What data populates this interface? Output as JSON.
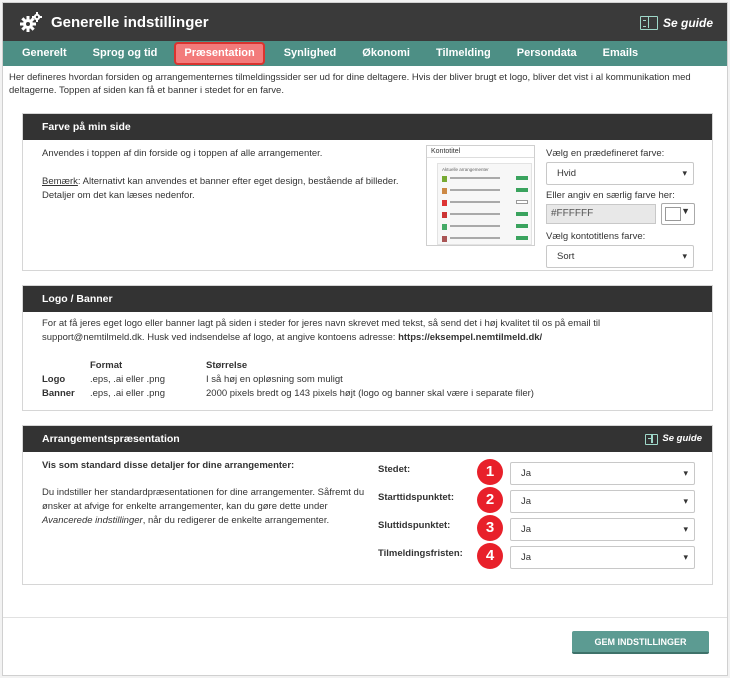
{
  "titlebar": {
    "title": "Generelle indstillinger",
    "guide_label": "Se guide"
  },
  "nav": {
    "tabs": [
      {
        "label": "Generelt",
        "active": false
      },
      {
        "label": "Sprog og tid",
        "active": false
      },
      {
        "label": "Præsentation",
        "active": true
      },
      {
        "label": "Synlighed",
        "active": false
      },
      {
        "label": "Økonomi",
        "active": false
      },
      {
        "label": "Tilmelding",
        "active": false
      },
      {
        "label": "Persondata",
        "active": false
      },
      {
        "label": "Emails",
        "active": false
      }
    ]
  },
  "intro": "Her defineres hvordan forsiden og arrangementernes tilmeldingssider ser ud for dine deltagere. Hvis der bliver brugt et logo, bliver det vist i al kommunikation med deltagerne. Toppen af siden kan få et banner i stedet for en farve.",
  "farve": {
    "heading": "Farve på min side",
    "line1": "Anvendes i toppen af din forside og i toppen af alle arrangementer.",
    "note_prefix": "Bemærk",
    "note_text": ": Alternativt kan anvendes et banner efter eget design, bestående af billeder. Detaljer om det kan læses nedenfor.",
    "thumb_title": "Kontotitel",
    "thumb_sub": "Aktuelle arrangementer",
    "predef_label": "Vælg en prædefineret farve:",
    "predef_value": "Hvid",
    "custom_label": "Eller angiv en særlig farve her:",
    "custom_value": "#FFFFFF",
    "title_color_label": "Vælg kontotitlens farve:",
    "title_color_value": "Sort",
    "colors": {
      "swatch": "#FFFFFF"
    }
  },
  "logo": {
    "heading": "Logo / Banner",
    "text1": "For at få jeres eget logo eller banner lagt på siden i steder for jeres navn skrevet med tekst, så send det i høj kvalitet til os på email til",
    "text2_prefix": "support@nemtilmeld.dk. Husk ved indsendelse af logo, at angive kontoens adresse: ",
    "text2_addr": "https://eksempel.nemtilmeld.dk/",
    "col_format": "Format",
    "col_size": "Størrelse",
    "rows": [
      {
        "name": "Logo",
        "format": ".eps, .ai eller .png",
        "size": "I så høj en opløsning som muligt"
      },
      {
        "name": "Banner",
        "format": ".eps, .ai eller .png",
        "size": "2000 pixels bredt og 143 pixels højt (logo og banner skal være i separate filer)"
      }
    ]
  },
  "arr": {
    "heading": "Arrangementspræsentation",
    "guide_label": "Se guide",
    "subhead": "Vis som standard disse detaljer for dine arrangementer:",
    "desc1": "Du indstiller her standardpræsentationen for dine arrangementer. Såfremt du ønsker at afvige for enkelte arrangementer, kan du gøre dette under ",
    "desc_italic": "Avancerede indstillinger",
    "desc2": ", når du redigerer de enkelte arrangementer.",
    "fields": [
      {
        "label": "Stedet:",
        "value": "Ja",
        "badge": "1"
      },
      {
        "label": "Starttidspunktet:",
        "value": "Ja",
        "badge": "2"
      },
      {
        "label": "Sluttidspunktet:",
        "value": "Ja",
        "badge": "3"
      },
      {
        "label": "Tilmeldingsfristen:",
        "value": "Ja",
        "badge": "4"
      }
    ]
  },
  "save_label": "GEM INDSTILLINGER"
}
